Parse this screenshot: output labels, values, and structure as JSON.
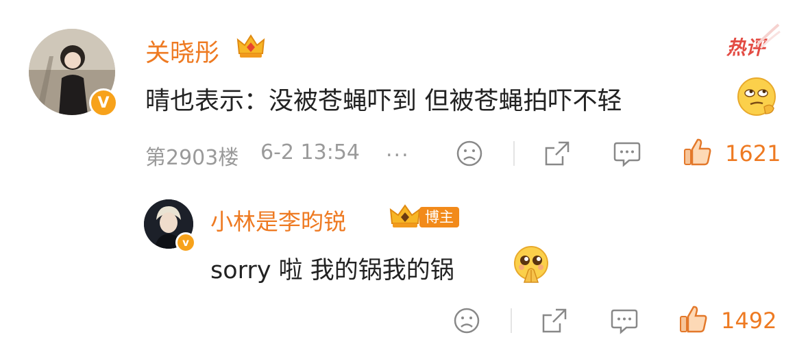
{
  "comment": {
    "author": "关晓彤",
    "hot_tag": "热评",
    "text": "晴也表示：没被苍蝇吓到 但被苍蝇拍吓不轻",
    "floor": "第2903楼",
    "time": "6-2 13:54",
    "more": "...",
    "likes": "1621",
    "verified_mark": "V"
  },
  "reply": {
    "author": "小林是李昀锐",
    "badge": "博主",
    "text": "sorry 啦 我的锅我的锅",
    "likes": "1492",
    "verified_mark": "v"
  },
  "colors": {
    "accent": "#ee7a22",
    "meta_gray": "#9a9a9a",
    "hot_red": "#e34b43",
    "badge_bg": "#f28a1a"
  },
  "icons": [
    "crown-icon",
    "dislike-face-icon",
    "share-icon",
    "comment-icon",
    "thumbs-up-icon",
    "rolling-eyes-emoji",
    "pleading-emoji"
  ]
}
